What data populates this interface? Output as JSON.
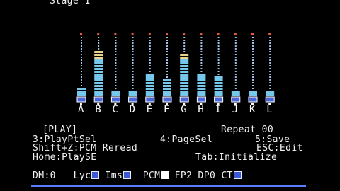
{
  "header": {
    "stage_label": "Stage 1"
  },
  "channels": [
    {
      "label": "A",
      "level": 0.15
    },
    {
      "label": "B",
      "level": 0.74
    },
    {
      "label": "C",
      "level": 0.1
    },
    {
      "label": "D",
      "level": 0.1
    },
    {
      "label": "E",
      "level": 0.38
    },
    {
      "label": "F",
      "level": 0.25
    },
    {
      "label": "G",
      "level": 0.68
    },
    {
      "label": "H",
      "level": 0.38
    },
    {
      "label": "I",
      "level": 0.3
    },
    {
      "label": "J",
      "level": 0.1
    },
    {
      "label": "K",
      "level": 0.1
    },
    {
      "label": "L",
      "level": 0.1
    }
  ],
  "colors": {
    "peak": "#e65a38",
    "dot": "#9fc1e6",
    "bar": "#75c8ec",
    "bar_top": "#e9d38c",
    "knob": "#4a66d8",
    "accent": "#5b7cff"
  },
  "status": {
    "mode": "[PLAY]",
    "repeat": "Repeat 00",
    "line1_left": "3:PlayPtSel",
    "line1_mid": "4:PageSel",
    "line1_right": "5:Save",
    "line2_left": "Shift+Z:PCM Reread",
    "line2_right": "ESC:Edit",
    "line3_left": "Home:PlaySE",
    "line3_right": "Tab:Initialize"
  },
  "flags": {
    "dm": "DM:0",
    "lyc": "Lyc",
    "ims": "Ims",
    "pcm": "PCM",
    "fp2": "FP2",
    "dp0": "DP0",
    "ct": "CT"
  }
}
